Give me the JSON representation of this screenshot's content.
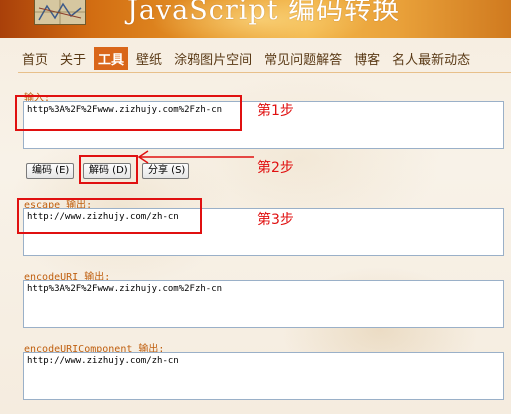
{
  "banner": {
    "title": "JavaScript 编码转换"
  },
  "nav": {
    "items": [
      "首页",
      "关于",
      "工具",
      "壁纸",
      "涂鸦图片空间",
      "常见问题解答",
      "博客",
      "名人最新动态"
    ],
    "active_index": 2
  },
  "input": {
    "label": "输入:",
    "value": "http%3A%2F%2Fwww.zizhujy.com%2Fzh-cn"
  },
  "buttons": {
    "encode": "编码 (E)",
    "decode": "解码 (D)",
    "share": "分享 (S)"
  },
  "outputs": {
    "escape": {
      "label": "escape 输出:",
      "value": "http://www.zizhujy.com/zh-cn"
    },
    "encode_uri": {
      "label": "encodeURI 输出:",
      "value": "http%3A%2F%2Fwww.zizhujy.com%2Fzh-cn"
    },
    "encode_uri_component": {
      "label": "encodeURIComponent 输出:",
      "value": "http://www.zizhujy.com/zh-cn"
    }
  },
  "annotations": {
    "step1": "第1步",
    "step2": "第2步",
    "step3": "第3步",
    "color": "#e01010"
  },
  "colors": {
    "accent": "#d9661a",
    "label": "#c06010",
    "banner": "#e59327"
  }
}
